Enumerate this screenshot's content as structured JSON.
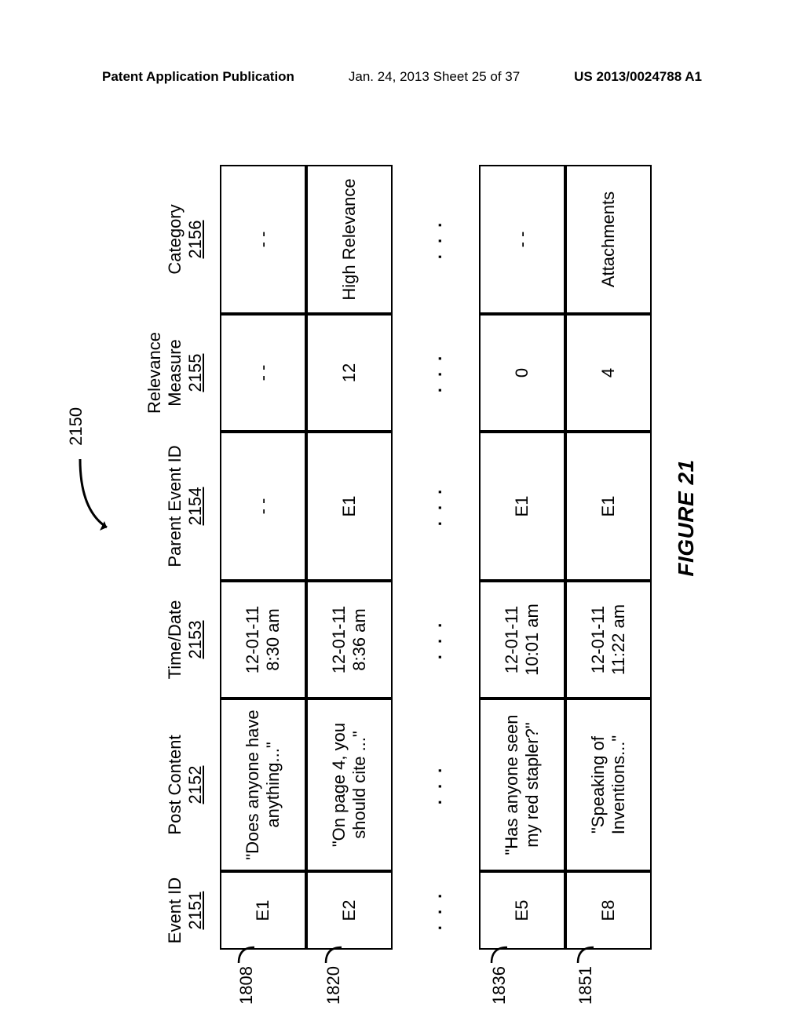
{
  "header": {
    "left": "Patent Application Publication",
    "center": "Jan. 24, 2013  Sheet 25 of 37",
    "right": "US 2013/0024788 A1"
  },
  "figure_ref": "2150",
  "figure_caption": "FIGURE 21",
  "columns": [
    {
      "label": "Event ID",
      "ref": "2151"
    },
    {
      "label": "Post Content",
      "ref": "2152"
    },
    {
      "label": "Time/Date",
      "ref": "2153"
    },
    {
      "label": "Parent Event ID",
      "ref": "2154"
    },
    {
      "label": "Relevance Measure",
      "ref": "2155"
    },
    {
      "label": "Category",
      "ref": "2156"
    }
  ],
  "ellipsis": ". . .",
  "rows": [
    {
      "ref": "1808",
      "event_id": "E1",
      "post_content": "\"Does anyone have anything...\"",
      "time_date": "12-01-11\n8:30 am",
      "parent_event": "- -",
      "relevance": "- -",
      "category": "- -"
    },
    {
      "ref": "1820",
      "event_id": "E2",
      "post_content": "\"On page 4, you should cite ...\"",
      "time_date": "12-01-11\n8:36 am",
      "parent_event": "E1",
      "relevance": "12",
      "category": "High Relevance"
    },
    {
      "ref": "1836",
      "event_id": "E5",
      "post_content": "\"Has anyone seen my red stapler?\"",
      "time_date": "12-01-11\n10:01 am",
      "parent_event": "E1",
      "relevance": "0",
      "category": "- -"
    },
    {
      "ref": "1851",
      "event_id": "E8",
      "post_content": "\"Speaking of Inventions...\"",
      "time_date": "12-01-11\n11:22 am",
      "parent_event": "E1",
      "relevance": "4",
      "category": "Attachments"
    }
  ]
}
